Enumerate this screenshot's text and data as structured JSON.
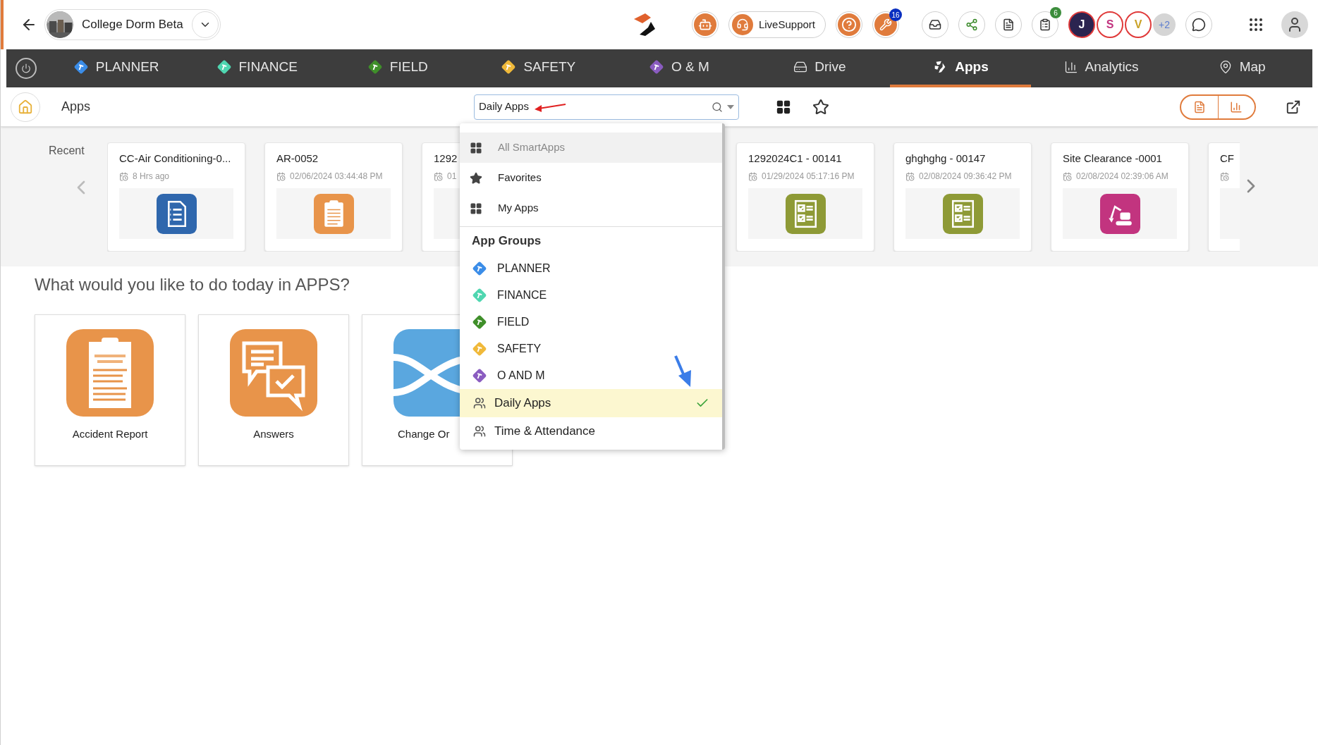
{
  "header": {
    "project": "College Dorm Beta",
    "live_support": "LiveSupport",
    "tools_badge": "16",
    "tasks_badge": "6",
    "avatars": [
      {
        "initial": "J",
        "color": "#2b2450"
      },
      {
        "initial": "S",
        "color": "#ffffff"
      },
      {
        "initial": "V",
        "color": "#ffffff"
      }
    ],
    "more_avatars": "+2"
  },
  "nav_tabs": [
    {
      "label": "PLANNER",
      "kind": "group",
      "color": "#3b8de8",
      "selected": false
    },
    {
      "label": "FINANCE",
      "kind": "group",
      "color": "#4fd6b0",
      "selected": false
    },
    {
      "label": "FIELD",
      "kind": "group",
      "color": "#3f8f2a",
      "selected": false
    },
    {
      "label": "SAFETY",
      "kind": "group",
      "color": "#f0b93a",
      "selected": false
    },
    {
      "label": "O & M",
      "kind": "group",
      "color": "#8a5cc0",
      "selected": false
    },
    {
      "label": "Drive",
      "kind": "drive",
      "selected": false
    },
    {
      "label": "Apps",
      "kind": "apps",
      "selected": true
    },
    {
      "label": "Analytics",
      "kind": "analytics",
      "selected": false
    },
    {
      "label": "Map",
      "kind": "map",
      "selected": false
    }
  ],
  "page_title": "Apps",
  "search": {
    "value": "Daily Apps"
  },
  "recent": {
    "label": "Recent",
    "cards": [
      {
        "title": "CC-Air Conditioning-0...",
        "time": "8 Hrs ago",
        "kind": "checklist",
        "color": "#2f67ad"
      },
      {
        "title": "AR-0052",
        "time": "02/06/2024 03:44:48 PM",
        "kind": "accident",
        "color": "#e8944a"
      },
      {
        "title": "1292",
        "time": "01"
      },
      {
        "title": "1292024C1 - 00141",
        "time": "01/29/2024 05:17:16 PM",
        "kind": "tasks",
        "color": "#8e9a36"
      },
      {
        "title": "ghghghg - 00147",
        "time": "02/08/2024 09:36:42 PM",
        "kind": "tasks",
        "color": "#8e9a36"
      },
      {
        "title": "Site Clearance -0001",
        "time": "02/08/2024 02:39:06 AM",
        "kind": "excavator",
        "color": "#c2347f"
      },
      {
        "title": "CF"
      }
    ]
  },
  "prompt": "What would you like to do today in APPS?",
  "tiles": [
    {
      "label": "Accident Report",
      "kind": "accident"
    },
    {
      "label": "Answers",
      "kind": "answers"
    },
    {
      "label": "Change Or",
      "kind": "change"
    }
  ],
  "dropdown": {
    "views": [
      {
        "label": "All SmartApps",
        "kind": "grid",
        "highlighted": true
      },
      {
        "label": "Favorites",
        "kind": "star",
        "highlighted": false
      },
      {
        "label": "My Apps",
        "kind": "grid",
        "highlighted": false
      }
    ],
    "groups_header": "App Groups",
    "groups": [
      {
        "label": "PLANNER",
        "color": "#3b8de8",
        "selected": false
      },
      {
        "label": "FINANCE",
        "color": "#4fd6b0",
        "selected": false
      },
      {
        "label": "FIELD",
        "color": "#3f8f2a",
        "selected": false
      },
      {
        "label": "SAFETY",
        "color": "#f0b93a",
        "selected": false
      },
      {
        "label": "O AND M",
        "color": "#8a5cc0",
        "selected": false
      }
    ],
    "sets": [
      {
        "label": "Daily Apps",
        "selected": true
      },
      {
        "label": "Time & Attendance",
        "selected": false
      }
    ]
  }
}
